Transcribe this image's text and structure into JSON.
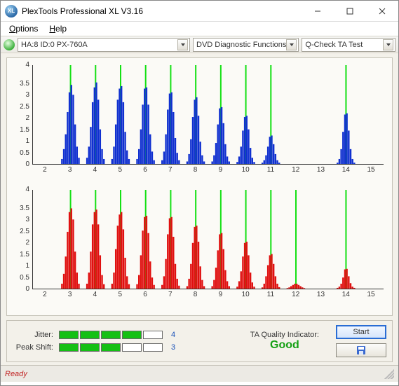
{
  "window": {
    "title": "PlexTools Professional XL V3.16",
    "app_icon_text": "XL"
  },
  "menu": {
    "options": "Options",
    "help": "Help"
  },
  "toolbar": {
    "device": "HA:8 ID:0   PX-760A",
    "funcgroup": "DVD Diagnostic Functions",
    "func": "Q-Check TA Test"
  },
  "meters": {
    "jitter_label": "Jitter:",
    "peakshift_label": "Peak Shift:",
    "jitter_value": "4",
    "peakshift_value": "3",
    "jitter_segments": [
      true,
      true,
      true,
      true,
      false
    ],
    "peakshift_segments": [
      true,
      true,
      true,
      false,
      false
    ]
  },
  "ta": {
    "label": "TA Quality Indicator:",
    "value": "Good"
  },
  "buttons": {
    "start": "Start",
    "save": ""
  },
  "status": {
    "text": "Ready"
  },
  "chart_data": [
    {
      "type": "bar",
      "color": "#1030d0",
      "xaxis": [
        2,
        3,
        4,
        5,
        6,
        7,
        8,
        9,
        10,
        11,
        12,
        13,
        14,
        15
      ],
      "ymax": 4,
      "yticks": [
        0,
        0.5,
        1,
        1.5,
        2,
        2.5,
        3,
        3.5,
        4
      ],
      "clusters": [
        {
          "center": 3,
          "bars": [
            0.2,
            0.6,
            1.2,
            2.1,
            2.9,
            3.2,
            2.8,
            1.6,
            0.7,
            0.25
          ]
        },
        {
          "center": 4,
          "bars": [
            0.25,
            0.7,
            1.5,
            2.5,
            3.1,
            3.3,
            2.6,
            1.4,
            0.6,
            0.2
          ]
        },
        {
          "center": 5,
          "bars": [
            0.2,
            0.7,
            1.6,
            2.6,
            3.05,
            3.15,
            2.5,
            1.3,
            0.55,
            0.2
          ]
        },
        {
          "center": 6,
          "bars": [
            0.2,
            0.6,
            1.4,
            2.4,
            3.05,
            3.1,
            2.4,
            1.2,
            0.5,
            0.15
          ]
        },
        {
          "center": 7,
          "bars": [
            0.15,
            0.5,
            1.2,
            2.2,
            2.85,
            2.9,
            2.1,
            1.05,
            0.45,
            0.15
          ]
        },
        {
          "center": 8,
          "bars": [
            0.1,
            0.4,
            1.0,
            1.9,
            2.6,
            2.7,
            1.95,
            0.9,
            0.35,
            0.1
          ]
        },
        {
          "center": 9,
          "bars": [
            0.1,
            0.35,
            0.85,
            1.6,
            2.25,
            2.3,
            1.65,
            0.8,
            0.3,
            0.1
          ]
        },
        {
          "center": 10,
          "bars": [
            0.08,
            0.3,
            0.7,
            1.35,
            1.9,
            1.95,
            1.4,
            0.65,
            0.25,
            0.08
          ]
        },
        {
          "center": 11,
          "bars": [
            0.05,
            0.15,
            0.35,
            0.7,
            1.1,
            1.15,
            0.8,
            0.4,
            0.15,
            0.05
          ]
        },
        {
          "center": 14,
          "bars": [
            0.05,
            0.2,
            0.6,
            1.3,
            2.0,
            2.05,
            1.35,
            0.6,
            0.2,
            0.05
          ]
        }
      ]
    },
    {
      "type": "bar",
      "color": "#e01010",
      "xaxis": [
        2,
        3,
        4,
        5,
        6,
        7,
        8,
        9,
        10,
        11,
        12,
        13,
        14,
        15
      ],
      "ymax": 4,
      "yticks": [
        0,
        0.5,
        1,
        1.5,
        2,
        2.5,
        3,
        3.5,
        4
      ],
      "clusters": [
        {
          "center": 3,
          "bars": [
            0.2,
            0.6,
            1.3,
            2.3,
            3.1,
            3.25,
            2.8,
            1.5,
            0.65,
            0.2
          ]
        },
        {
          "center": 4,
          "bars": [
            0.2,
            0.65,
            1.5,
            2.6,
            3.1,
            3.2,
            2.6,
            1.35,
            0.55,
            0.18
          ]
        },
        {
          "center": 5,
          "bars": [
            0.2,
            0.65,
            1.6,
            2.55,
            3.0,
            3.1,
            2.4,
            1.25,
            0.5,
            0.18
          ]
        },
        {
          "center": 6,
          "bars": [
            0.18,
            0.55,
            1.35,
            2.35,
            2.9,
            2.95,
            2.25,
            1.1,
            0.45,
            0.15
          ]
        },
        {
          "center": 7,
          "bars": [
            0.15,
            0.5,
            1.2,
            2.2,
            2.85,
            2.9,
            2.1,
            1.0,
            0.4,
            0.12
          ]
        },
        {
          "center": 8,
          "bars": [
            0.1,
            0.4,
            1.0,
            1.85,
            2.5,
            2.55,
            1.9,
            0.9,
            0.35,
            0.1
          ]
        },
        {
          "center": 9,
          "bars": [
            0.1,
            0.35,
            0.85,
            1.55,
            2.2,
            2.25,
            1.6,
            0.75,
            0.3,
            0.1
          ]
        },
        {
          "center": 10,
          "bars": [
            0.08,
            0.3,
            0.7,
            1.3,
            1.85,
            1.9,
            1.35,
            0.65,
            0.25,
            0.08
          ]
        },
        {
          "center": 11,
          "bars": [
            0.05,
            0.2,
            0.5,
            0.95,
            1.35,
            1.4,
            1.0,
            0.5,
            0.2,
            0.06
          ]
        },
        {
          "center": 12,
          "bars": [
            0.02,
            0.05,
            0.1,
            0.15,
            0.2,
            0.2,
            0.15,
            0.1,
            0.05,
            0.02
          ]
        },
        {
          "center": 14,
          "bars": [
            0.03,
            0.08,
            0.2,
            0.45,
            0.78,
            0.8,
            0.5,
            0.22,
            0.08,
            0.03
          ]
        }
      ]
    }
  ]
}
